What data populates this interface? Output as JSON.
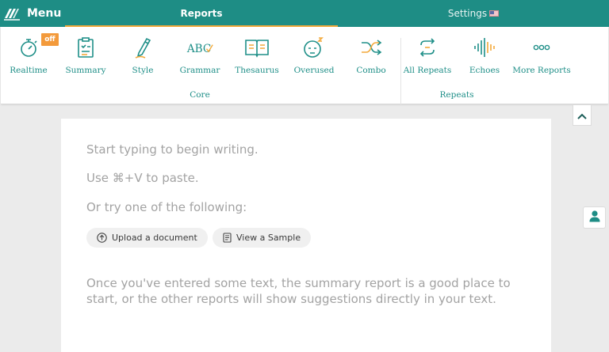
{
  "header": {
    "menu_label": "Menu",
    "tabs": [
      {
        "label": "Reports",
        "active": true
      },
      {
        "label": "Settings",
        "active": false
      }
    ]
  },
  "ribbon": {
    "realtime_badge": "off",
    "tools": [
      {
        "label": "Realtime",
        "icon": "stopwatch-icon"
      },
      {
        "label": "Summary",
        "icon": "clipboard-icon"
      },
      {
        "label": "Style",
        "icon": "pencil-icon"
      },
      {
        "label": "Grammar",
        "icon": "abc-check-icon"
      },
      {
        "label": "Thesaurus",
        "icon": "book-icon"
      },
      {
        "label": "Overused",
        "icon": "sleepy-face-icon"
      },
      {
        "label": "Combo",
        "icon": "shuffle-icon"
      },
      {
        "label": "All Repeats",
        "icon": "repeat-icon"
      },
      {
        "label": "Echoes",
        "icon": "sound-wave-icon"
      },
      {
        "label": "More Reports",
        "icon": "more-icon"
      }
    ],
    "groups": [
      {
        "label": "Core"
      },
      {
        "label": "Repeats"
      }
    ]
  },
  "editor": {
    "line1": "Start typing to begin writing.",
    "line2": "Use ⌘+V to paste.",
    "line3": "Or try one of the following:",
    "upload_label": "Upload a document",
    "sample_label": "View a Sample",
    "hint_line1": "Once you've entered some text, the summary report is a good place to",
    "hint_line2": "start, or the other reports will show suggestions directly in your text."
  },
  "colors": {
    "teal": "#1e8d85",
    "orange": "#f3a93a",
    "placeholder": "#a3a3a3"
  }
}
